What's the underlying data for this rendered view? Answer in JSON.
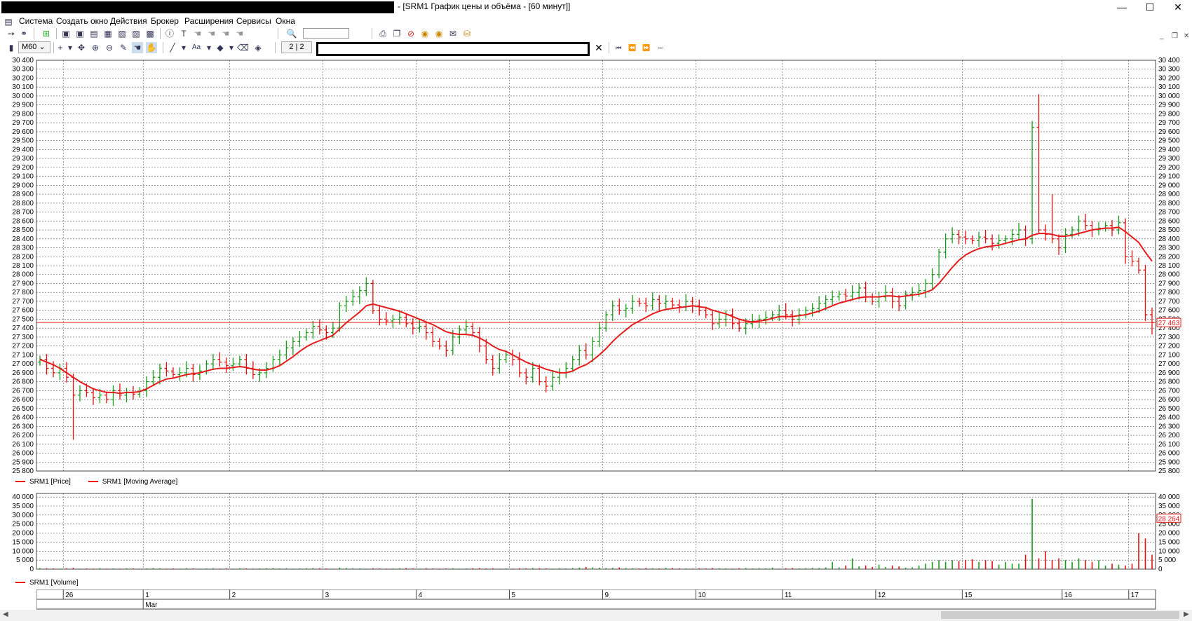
{
  "window": {
    "title": "- [SRM1 График цены и объёма - [60 минут]]",
    "buttons": [
      "—",
      "☐",
      "✕"
    ]
  },
  "menu": [
    "Система",
    "Создать окно",
    "Действия",
    "Брокер",
    "Расширения",
    "Сервисы",
    "Окна"
  ],
  "toolbar2": {
    "timeframe": "M60",
    "page": "2 | 2"
  },
  "price_legend": [
    "SRM1 [Price]",
    "SRM1 [Moving Average]"
  ],
  "volume_legend": [
    "SRM1 [Volume]"
  ],
  "price_axis": {
    "min": 25800,
    "max": 30400,
    "step": 100,
    "current_label": "27 463",
    "current_value": 27463
  },
  "volume_axis": {
    "ticks": [
      "40 000",
      "35 000",
      "30 000",
      "25 000",
      "20 000",
      "15 000",
      "10 000",
      "5 000",
      "0"
    ],
    "current_label": "28 264"
  },
  "date_axis": {
    "days": [
      "26",
      "1",
      "2",
      "3",
      "4",
      "5",
      "9",
      "10",
      "11",
      "12",
      "15",
      "16",
      "17"
    ],
    "month": "Mar"
  },
  "colors": {
    "up": "#1a9a1a",
    "down": "#e01010",
    "ma": "#e61c1c",
    "grid": "#555555",
    "hline": "#e61c1c"
  },
  "chart_data": {
    "type": "ohlc+line+bar",
    "symbol": "SRM1",
    "timeframe": "60 минут",
    "ylim": [
      25800,
      30400
    ],
    "current_price": 27463,
    "series": [
      {
        "name": "SRM1 [Price]",
        "type": "ohlc",
        "close": [
          27050,
          26950,
          26900,
          26950,
          26850,
          26650,
          26700,
          26680,
          26620,
          26650,
          26600,
          26700,
          26650,
          26680,
          26660,
          26700,
          26800,
          26850,
          26950,
          26920,
          26880,
          26900,
          26950,
          26880,
          26920,
          27000,
          27050,
          27020,
          26980,
          27000,
          27050,
          26950,
          26880,
          26900,
          26950,
          27050,
          27100,
          27180,
          27250,
          27300,
          27350,
          27420,
          27380,
          27350,
          27400,
          27650,
          27700,
          27750,
          27820,
          27900,
          27600,
          27500,
          27480,
          27500,
          27520,
          27450,
          27400,
          27420,
          27350,
          27250,
          27200,
          27150,
          27300,
          27380,
          27420,
          27350,
          27200,
          27050,
          26950,
          27050,
          27100,
          27050,
          26900,
          26850,
          26950,
          26800,
          26750,
          26850,
          26900,
          26950,
          27050,
          27150,
          27100,
          27250,
          27400,
          27550,
          27650,
          27600,
          27620,
          27700,
          27680,
          27650,
          27720,
          27680,
          27700,
          27660,
          27640,
          27700,
          27650,
          27600,
          27550,
          27450,
          27500,
          27550,
          27450,
          27400,
          27450,
          27480,
          27500,
          27520,
          27550,
          27600,
          27550,
          27500,
          27550,
          27600,
          27620,
          27680,
          27720,
          27750,
          27780,
          27760,
          27800,
          27850,
          27750,
          27700,
          27750,
          27800,
          27700,
          27650,
          27780,
          27800,
          27820,
          27900,
          28000,
          28250,
          28400,
          28450,
          28420,
          28400,
          28380,
          28420,
          28400,
          28350,
          28380,
          28400,
          28450,
          28500,
          28400,
          29650,
          28500,
          28450,
          28400,
          28300,
          28450,
          28500,
          28600,
          28550,
          28500,
          28520,
          28550,
          28500,
          28580,
          28200,
          28150,
          28050,
          27550,
          27463
        ]
      },
      {
        "name": "SRM1 [Moving Average]",
        "type": "line",
        "values": [
          27050,
          27020,
          26990,
          26950,
          26900,
          26850,
          26800,
          26760,
          26720,
          26700,
          26680,
          26680,
          26670,
          26680,
          26680,
          26690,
          26720,
          26760,
          26800,
          26830,
          26840,
          26860,
          26880,
          26890,
          26900,
          26920,
          26940,
          26950,
          26950,
          26960,
          26970,
          26960,
          26940,
          26930,
          26930,
          26950,
          26980,
          27030,
          27080,
          27140,
          27190,
          27230,
          27260,
          27290,
          27320,
          27390,
          27460,
          27520,
          27580,
          27650,
          27670,
          27650,
          27630,
          27610,
          27590,
          27560,
          27530,
          27500,
          27470,
          27440,
          27400,
          27360,
          27340,
          27330,
          27330,
          27320,
          27290,
          27250,
          27200,
          27160,
          27140,
          27100,
          27060,
          27020,
          26990,
          26970,
          26940,
          26920,
          26900,
          26900,
          26920,
          26960,
          26990,
          27040,
          27100,
          27170,
          27250,
          27320,
          27380,
          27440,
          27480,
          27520,
          27560,
          27590,
          27610,
          27620,
          27630,
          27640,
          27650,
          27640,
          27630,
          27600,
          27580,
          27560,
          27530,
          27500,
          27480,
          27470,
          27480,
          27490,
          27510,
          27530,
          27530,
          27530,
          27540,
          27550,
          27570,
          27590,
          27620,
          27650,
          27680,
          27700,
          27720,
          27740,
          27750,
          27750,
          27750,
          27760,
          27760,
          27750,
          27760,
          27770,
          27780,
          27800,
          27830,
          27900,
          27990,
          28080,
          28160,
          28220,
          28260,
          28290,
          28310,
          28320,
          28330,
          28350,
          28370,
          28390,
          28400,
          28440,
          28460,
          28460,
          28450,
          28430,
          28430,
          28440,
          28460,
          28480,
          28500,
          28510,
          28520,
          28520,
          28530,
          28480,
          28420,
          28360,
          28250,
          28150
        ]
      },
      {
        "name": "SRM1 [Volume]",
        "type": "bar",
        "values": [
          600,
          500,
          400,
          300,
          500,
          700,
          300,
          400,
          300,
          500,
          300,
          400,
          300,
          500,
          400,
          300,
          400,
          600,
          500,
          300,
          400,
          300,
          500,
          400,
          300,
          400,
          500,
          300,
          400,
          300,
          500,
          400,
          300,
          400,
          500,
          600,
          400,
          500,
          300,
          400,
          500,
          600,
          500,
          400,
          300,
          800,
          600,
          500,
          400,
          300,
          500,
          400,
          300,
          400,
          500,
          600,
          400,
          300,
          500,
          400,
          300,
          400,
          500,
          300,
          400,
          500,
          600,
          400,
          500,
          300,
          400,
          300,
          500,
          400,
          600,
          500,
          400,
          300,
          500,
          400,
          600,
          800,
          1200,
          900,
          800,
          600,
          700,
          900,
          600,
          500,
          400,
          600,
          500,
          400,
          700,
          600,
          500,
          400,
          300,
          500,
          400,
          600,
          500,
          400,
          300,
          500,
          600,
          400,
          500,
          400,
          800,
          300,
          500,
          600,
          400,
          500,
          700,
          600,
          900,
          4000,
          1000,
          2000,
          6000,
          1500,
          2000,
          1200,
          2500,
          1200,
          2000,
          1500,
          800,
          1000,
          2000,
          3000,
          4000,
          5000,
          4000,
          5000,
          4500,
          5000,
          5500,
          4000,
          5000,
          4500,
          2500,
          4000,
          3000,
          3000,
          8000,
          39000,
          6000,
          10000,
          5000,
          6000,
          5000,
          4000,
          6000,
          5000,
          4000,
          5000,
          2000,
          3000,
          2500,
          2000,
          3000,
          20000,
          17000,
          8000,
          8000,
          28264
        ]
      }
    ]
  }
}
